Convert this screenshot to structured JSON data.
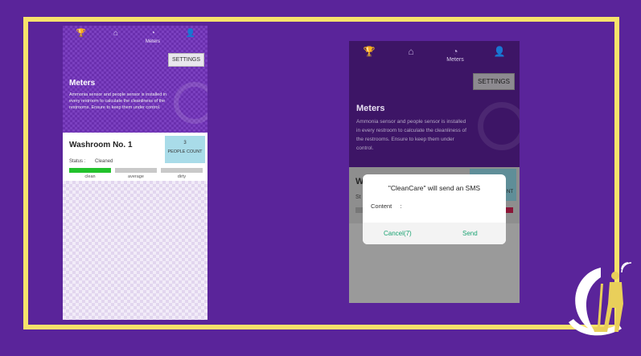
{
  "left_phone": {
    "nav": [
      {
        "icon": "trophy-icon",
        "label": ""
      },
      {
        "icon": "home-icon",
        "label": ""
      },
      {
        "icon": "meter-icon",
        "label": "Meters"
      },
      {
        "icon": "user-icon",
        "label": ""
      }
    ],
    "settings_label": "SETTINGS",
    "title": "Meters",
    "description": "Ammonia sensor and people sensor is installed in every restroom to calculate the cleanliness of the restrooms. Ensure to keep them under control.",
    "card": {
      "title": "Washroom No. 1",
      "people_count_value": "3",
      "people_count_label": "PEOPLE COUNT",
      "status_label": "Status :",
      "status_value": "Cleaned",
      "levels": [
        "clean",
        "average",
        "dirty"
      ],
      "active_level": "clean"
    }
  },
  "right_phone": {
    "nav": [
      {
        "icon": "trophy-icon",
        "label": ""
      },
      {
        "icon": "home-icon",
        "label": ""
      },
      {
        "icon": "meter-icon",
        "label": "Meters"
      },
      {
        "icon": "user-icon",
        "label": ""
      }
    ],
    "settings_label": "SETTINGS",
    "title": "Meters",
    "description": "Ammonia sensor and people sensor is installed in every restroom to calculate the cleanliness of the restrooms. Ensure to keep them under control.",
    "card_title_partial": "W",
    "count_partial": "NT",
    "status_partial": "St",
    "dialog": {
      "title": "\"CleanCare\" will send an SMS",
      "content_label": "Content",
      "content_separator": ":",
      "cancel_label": "Cancel(7)",
      "send_label": "Send"
    }
  },
  "colors": {
    "background": "#5a249a",
    "frame": "#f7e26b",
    "clean": "#22c22c",
    "dirty_bar": "#8a1536",
    "dialog_button": "#1aa372"
  }
}
